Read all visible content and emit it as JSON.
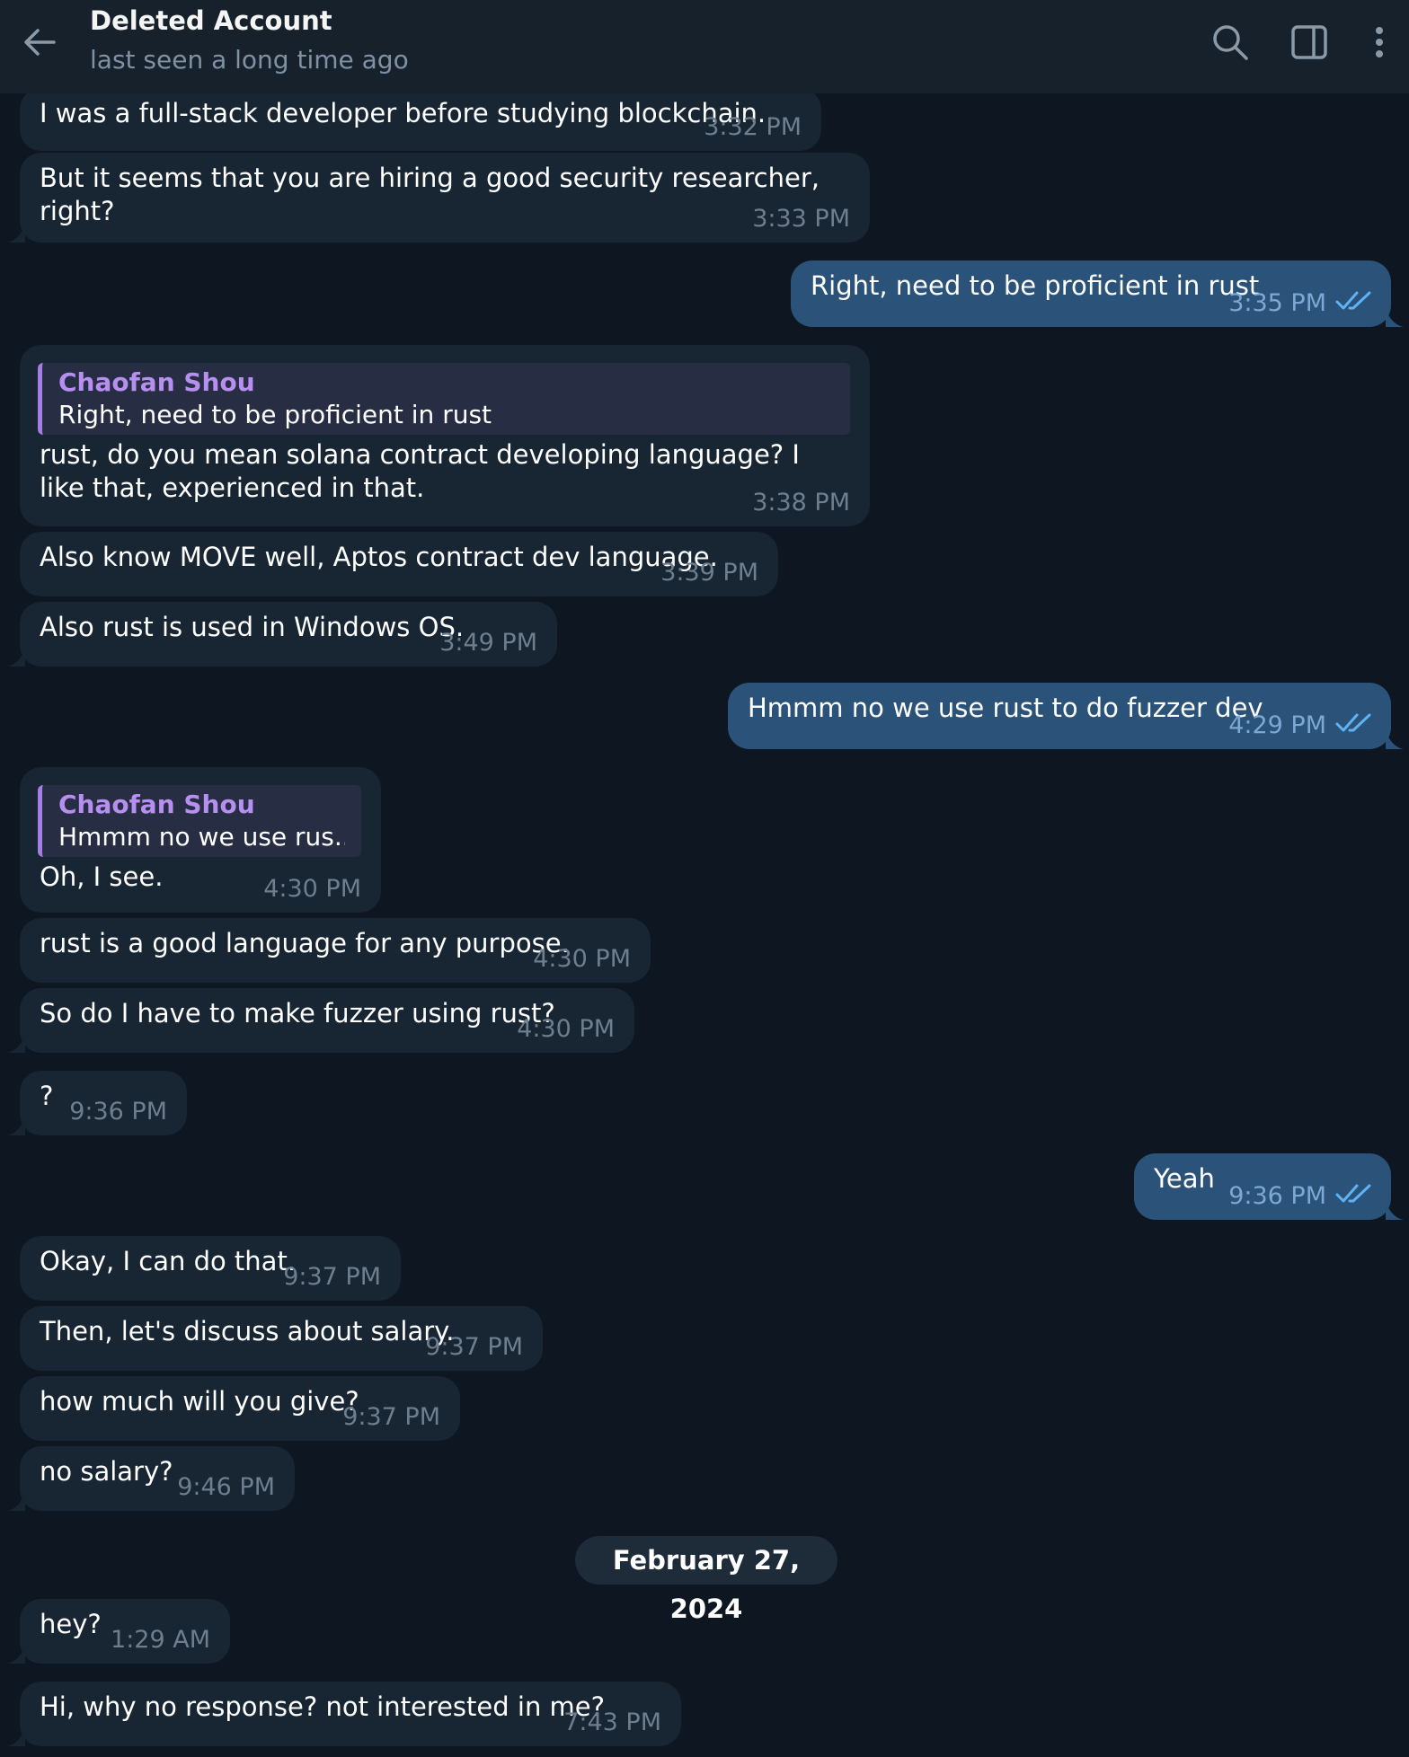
{
  "header": {
    "title": "Deleted Account",
    "subtitle": "last seen a long time ago"
  },
  "colors": {
    "background": "#0e1621",
    "header": "#17212b",
    "incoming_bubble": "#182533",
    "outgoing_bubble": "#2b5278",
    "reply_accent": "#a67ce5",
    "read_check": "#5fb3f5"
  },
  "icons": [
    "back-arrow-icon",
    "search-icon",
    "sidebar-toggle-icon",
    "more-vert-icon",
    "double-check-icon"
  ],
  "messages": [
    {
      "dir": "in",
      "text": "I was a full-stack developer before studying blockchain.",
      "time": "3:32 PM"
    },
    {
      "dir": "in",
      "text": "But it seems that you are hiring a good security researcher, right?",
      "time": "3:33 PM"
    },
    {
      "dir": "out",
      "text": "Right, need to be proficient in rust",
      "time": "3:35 PM",
      "read": true
    },
    {
      "dir": "in",
      "reply": {
        "name": "Chaofan Shou",
        "text": "Right, need to be proficient in rust"
      },
      "text": "rust, do you mean solana contract developing language? I like that, experienced in that.",
      "time": "3:38 PM"
    },
    {
      "dir": "in",
      "text": "Also know MOVE well, Aptos contract dev language.",
      "time": "3:39 PM"
    },
    {
      "dir": "in",
      "text": "Also rust is used in Windows OS.",
      "time": "3:49 PM"
    },
    {
      "dir": "out",
      "text": "Hmmm no we use rust to do fuzzer dev",
      "time": "4:29 PM",
      "read": true
    },
    {
      "dir": "in",
      "reply": {
        "name": "Chaofan Shou",
        "text": "Hmmm no we use rus..."
      },
      "text": "Oh, I see.",
      "time": "4:30 PM"
    },
    {
      "dir": "in",
      "text": "rust is a good language for any purpose.",
      "time": "4:30 PM"
    },
    {
      "dir": "in",
      "text": "So do I have to make fuzzer using rust?",
      "time": "4:30 PM"
    },
    {
      "dir": "in",
      "text": "?",
      "time": "9:36 PM"
    },
    {
      "dir": "out",
      "text": "Yeah",
      "time": "9:36 PM",
      "read": true
    },
    {
      "dir": "in",
      "text": "Okay, I can do that.",
      "time": "9:37 PM"
    },
    {
      "dir": "in",
      "text": "Then, let's discuss about salary.",
      "time": "9:37 PM"
    },
    {
      "dir": "in",
      "text": "how much will you give?",
      "time": "9:37 PM"
    },
    {
      "dir": "in",
      "text": "no salary?",
      "time": "9:46 PM"
    },
    {
      "dir": "in",
      "text": "hey?",
      "time": "1:29 AM"
    },
    {
      "dir": "in",
      "text": "Hi, why no response? not interested in me?",
      "time": "7:43 PM"
    }
  ],
  "date_separator": "February 27, 2024"
}
